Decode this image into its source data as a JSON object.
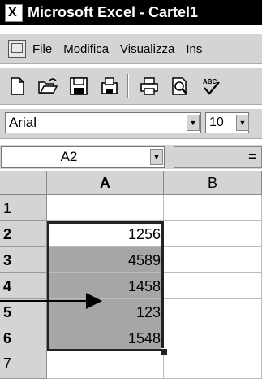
{
  "window": {
    "title": "Microsoft Excel - Cartel1"
  },
  "menu": {
    "items": [
      {
        "label": "File",
        "underline": "F"
      },
      {
        "label": "Modifica",
        "underline": "M"
      },
      {
        "label": "Visualizza",
        "underline": "V"
      },
      {
        "label": "Ins",
        "underline": "I"
      }
    ]
  },
  "toolbar": {
    "buttons": [
      "new-icon",
      "open-icon",
      "save-icon",
      "save-network-icon",
      "print-icon",
      "print-preview-icon",
      "spelling-icon"
    ]
  },
  "format": {
    "font": "Arial",
    "size": "10"
  },
  "formula": {
    "name_box": "A2",
    "equals": "="
  },
  "sheet": {
    "columns": [
      "A",
      "B"
    ],
    "rows": [
      "1",
      "2",
      "3",
      "4",
      "5",
      "6",
      "7"
    ],
    "cells": {
      "A1": "",
      "A2": "1256",
      "A3": "4589",
      "A4": "1458",
      "A5": "123",
      "A6": "1548",
      "A7": ""
    },
    "selection": "A2:A6",
    "selection_color": "#a6a6a6"
  }
}
